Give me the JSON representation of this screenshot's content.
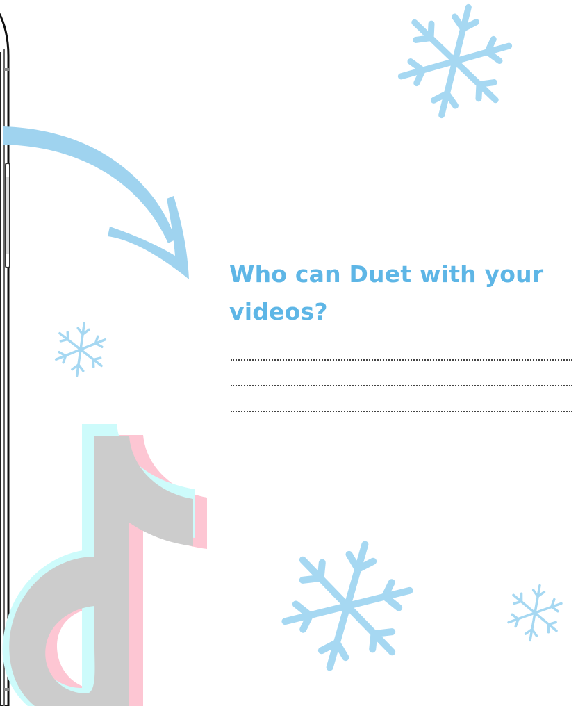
{
  "question": {
    "text": "Who can Duet with your videos?"
  },
  "answer_lines": [
    {
      "value": ""
    },
    {
      "value": ""
    },
    {
      "value": ""
    }
  ],
  "colors": {
    "question_text": "#5eb6e6",
    "snowflake": "#a6d8f2",
    "arrow": "#9fd3ef",
    "logo_gray": "#cccccc",
    "logo_cyan": "#cdfbfb",
    "logo_pink": "#fdc6d3",
    "phone_frame": "#1a1a1a"
  },
  "icons": {
    "arrow": "curved-arrow-icon",
    "logo": "tiktok-note-logo",
    "snowflake": "snowflake-icon"
  }
}
